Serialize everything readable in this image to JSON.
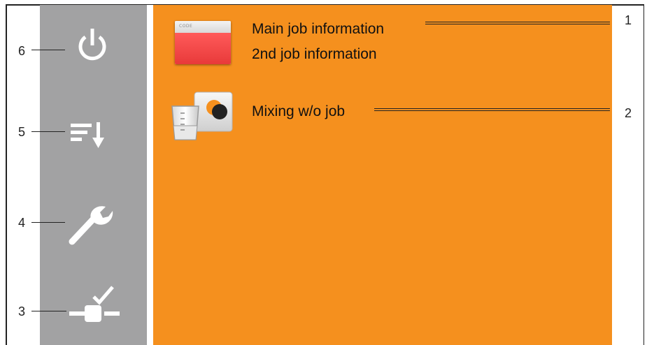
{
  "main_panel": {
    "job_card": {
      "code_label": "CODE",
      "main_line": "Main job information",
      "second_line": "2nd job information"
    },
    "mixing_item": {
      "label": "Mixing w/o job"
    }
  },
  "sidebar": {
    "items": [
      {
        "icon": "power-icon",
        "callout": "6"
      },
      {
        "icon": "sort-down-icon",
        "callout": "5"
      },
      {
        "icon": "wrench-icon",
        "callout": "4"
      },
      {
        "icon": "valve-check-icon",
        "callout": "3"
      }
    ]
  },
  "callouts": {
    "job_info": "1",
    "mixing": "2"
  },
  "colors": {
    "main_background": "#f5901e",
    "sidebar_background": "#a2a2a3",
    "icon": "#ffffff",
    "code_card_red": "#e83a3a"
  }
}
